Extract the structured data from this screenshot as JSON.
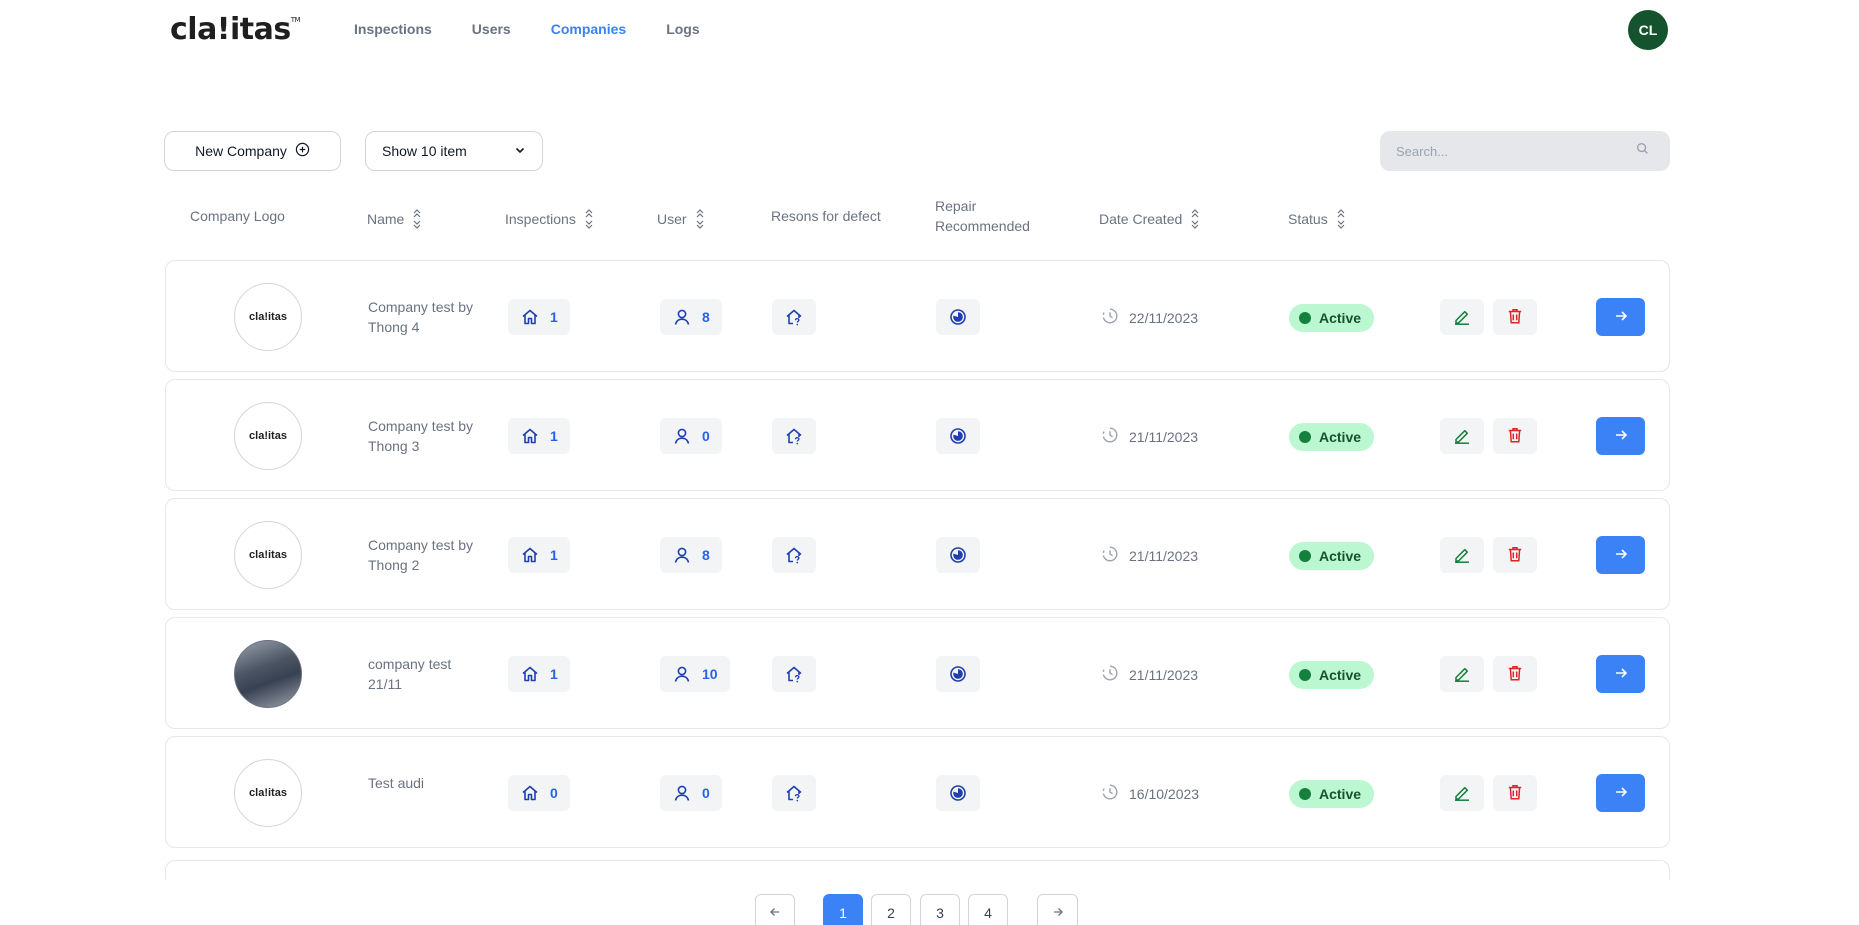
{
  "brand": {
    "logo_text": "cla!itas",
    "logo_tm": "TM"
  },
  "nav": {
    "items": [
      {
        "label": "Inspections",
        "active": false
      },
      {
        "label": "Users",
        "active": false
      },
      {
        "label": "Companies",
        "active": true
      },
      {
        "label": "Logs",
        "active": false
      }
    ]
  },
  "user": {
    "initials": "CL"
  },
  "toolbar": {
    "new_company_label": "New Company",
    "show_select_value": "Show 10 item",
    "search_placeholder": "Search..."
  },
  "table": {
    "headers": {
      "logo": "Company Logo",
      "name": "Name",
      "inspections": "Inspections",
      "user": "User",
      "reasons": "Resons for defect",
      "repair_line1": "Repair",
      "repair_line2": "Recommended",
      "date": "Date Created",
      "status": "Status"
    },
    "rows": [
      {
        "logo_text": "cla!itas",
        "logo_type": "text",
        "name": "Company test by Thong 4",
        "inspections": "1",
        "users": "8",
        "date": "22/11/2023",
        "status": "Active"
      },
      {
        "logo_text": "cla!itas",
        "logo_type": "text",
        "name": "Company test by Thong 3",
        "inspections": "1",
        "users": "0",
        "date": "21/11/2023",
        "status": "Active"
      },
      {
        "logo_text": "cla!itas",
        "logo_type": "text",
        "name": "Company test by Thong 2",
        "inspections": "1",
        "users": "8",
        "date": "21/11/2023",
        "status": "Active"
      },
      {
        "logo_text": "",
        "logo_type": "photo",
        "name": "company test 21/11",
        "inspections": "1",
        "users": "10",
        "date": "21/11/2023",
        "status": "Active"
      },
      {
        "logo_text": "cla!itas",
        "logo_type": "text",
        "name": "Test audi",
        "inspections": "0",
        "users": "0",
        "date": "16/10/2023",
        "status": "Active"
      }
    ]
  },
  "pagination": {
    "pages": [
      "1",
      "2",
      "3",
      "4"
    ],
    "current": "1"
  },
  "colors": {
    "accent": "#3b82f6",
    "avatar_bg": "#14532d",
    "status_bg": "#bbf7d0",
    "status_dot": "#15803d",
    "edit_icon": "#15803d",
    "delete_icon": "#dc2626"
  },
  "icons": {
    "new_company": "plus-circle-icon",
    "select": "chevron-down-icon",
    "search": "search-icon",
    "inspections": "home-icon",
    "users": "user-icon",
    "reasons": "home-question-icon",
    "repair": "circle-dot-icon",
    "date": "clock-icon",
    "edit": "pencil-icon",
    "delete": "trash-icon",
    "go": "arrow-right-icon",
    "prev": "arrow-left-icon",
    "next": "arrow-right-icon"
  }
}
